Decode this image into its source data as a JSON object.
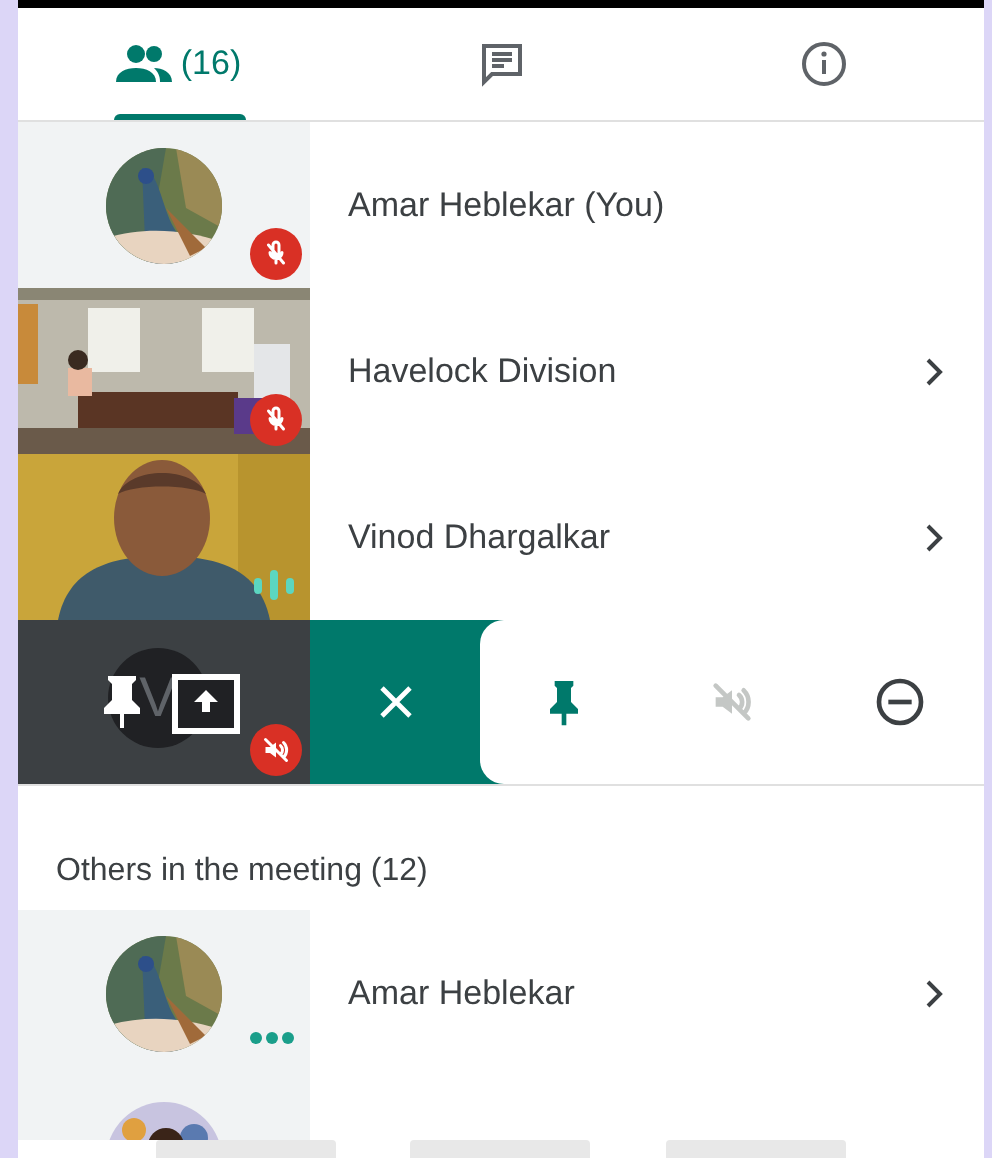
{
  "tabs": [
    {
      "kind": "people",
      "label": "(16)",
      "selected": true
    },
    {
      "kind": "chat",
      "selected": false
    },
    {
      "kind": "info",
      "selected": false
    }
  ],
  "participants": [
    {
      "name": "Amar Heblekar (You)",
      "tile": {
        "kind": "avatar"
      },
      "indicator": {
        "kind": "mic_off"
      },
      "chevron": false
    },
    {
      "name": "Havelock Division",
      "tile": {
        "kind": "video"
      },
      "indicator": {
        "kind": "mic_off"
      },
      "chevron": true
    },
    {
      "name": "Vinod Dhargalkar",
      "tile": {
        "kind": "video"
      },
      "indicator": {
        "kind": "audio_level"
      },
      "chevron": true
    }
  ],
  "action_row": {
    "tile_initial": "V",
    "tile_muted": true,
    "actions": [
      {
        "kind": "pin",
        "disabled": false
      },
      {
        "kind": "mute",
        "disabled": true
      },
      {
        "kind": "remove",
        "disabled": false
      }
    ]
  },
  "others": {
    "heading": "Others in the meeting (12)",
    "items": [
      {
        "name": "Amar Heblekar",
        "tile": {
          "kind": "avatar"
        },
        "indicator": {
          "kind": "dots"
        },
        "chevron": true
      },
      {
        "tile": {
          "kind": "avatar"
        }
      }
    ]
  }
}
